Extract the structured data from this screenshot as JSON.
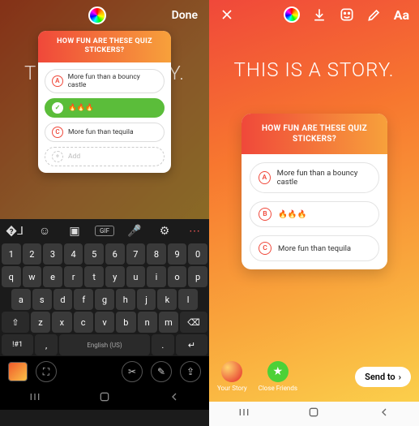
{
  "left": {
    "done_label": "Done",
    "bg_text": "THIS IS A STORY.",
    "quiz": {
      "question": "HOW FUN ARE THESE QUIZ STICKERS?",
      "options": [
        {
          "letter": "A",
          "text": "More fun than a bouncy castle",
          "selected": false
        },
        {
          "letter": "✓",
          "text": "🔥🔥🔥",
          "selected": true
        },
        {
          "letter": "C",
          "text": "More fun than tequila",
          "selected": false
        }
      ],
      "add_label": "Add"
    },
    "keyboard": {
      "numrow": [
        "1",
        "2",
        "3",
        "4",
        "5",
        "6",
        "7",
        "8",
        "9",
        "0"
      ],
      "row1": [
        "q",
        "w",
        "e",
        "r",
        "t",
        "y",
        "u",
        "i",
        "o",
        "p"
      ],
      "row2": [
        "a",
        "s",
        "d",
        "f",
        "g",
        "h",
        "j",
        "k",
        "l"
      ],
      "row3_shift": "⇧",
      "row3": [
        "z",
        "x",
        "c",
        "v",
        "b",
        "n",
        "m"
      ],
      "row3_back": "⌫",
      "sym": "!#1",
      "comma": ",",
      "lang": "English (US)",
      "period": ".",
      "enter": "↵"
    }
  },
  "right": {
    "aa_label": "Aa",
    "bg_text": "THIS IS A STORY.",
    "quiz": {
      "question": "HOW FUN ARE THESE QUIZ STICKERS?",
      "options": [
        {
          "letter": "A",
          "text": "More fun than a bouncy castle"
        },
        {
          "letter": "B",
          "text": "🔥🔥🔥"
        },
        {
          "letter": "C",
          "text": "More fun than tequila"
        }
      ]
    },
    "share": {
      "your_story": "Your Story",
      "close_friends": "Close Friends",
      "send_to": "Send to"
    }
  }
}
